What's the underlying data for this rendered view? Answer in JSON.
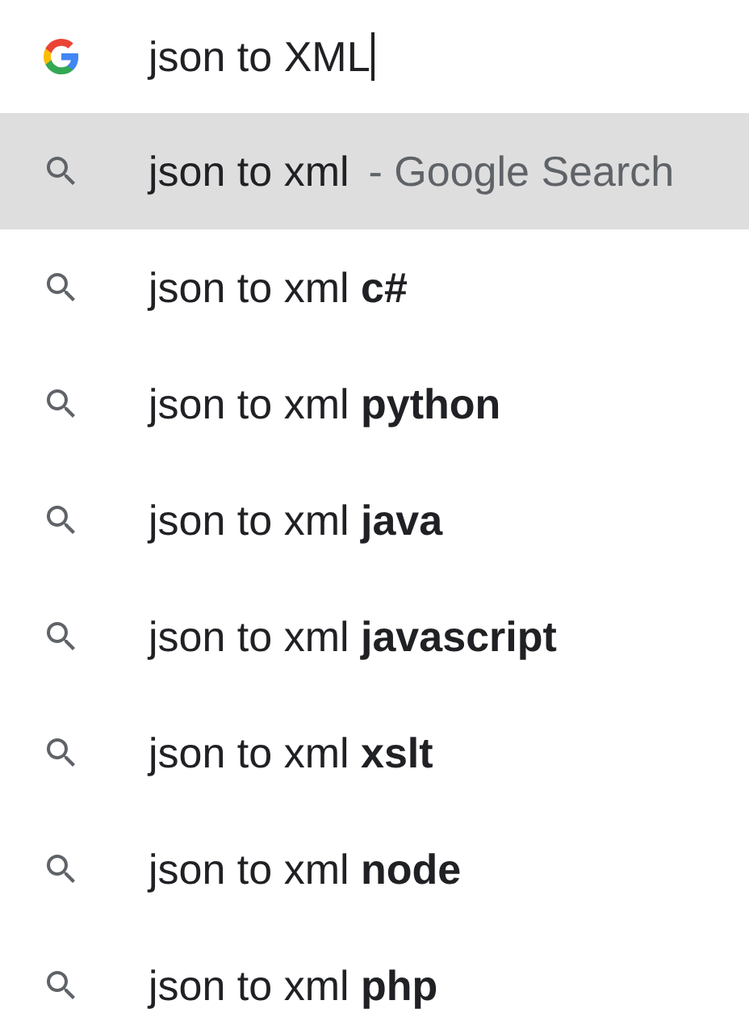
{
  "search": {
    "value": "json to XML",
    "focused": true
  },
  "suggestions": [
    {
      "text": "json to xml",
      "suffix": "- Google Search",
      "selected": true
    },
    {
      "text": "json to xml **c#**",
      "selected": false
    },
    {
      "text": "json to xml **python**",
      "selected": false
    },
    {
      "text": "json to xml **java**",
      "selected": false
    },
    {
      "text": "json to xml **javascript**",
      "selected": false
    },
    {
      "text": "json to xml **xslt**",
      "selected": false
    },
    {
      "text": "json to xml **node**",
      "selected": false
    },
    {
      "text": "json to xml **php**",
      "selected": false
    }
  ]
}
